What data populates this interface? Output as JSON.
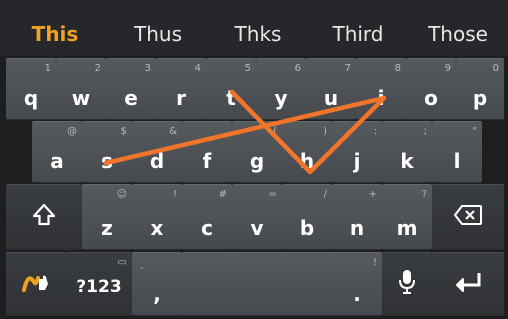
{
  "suggestions": [
    "This",
    "Thus",
    "Thks",
    "Third",
    "Those"
  ],
  "rows": {
    "row1": [
      {
        "char": "q",
        "hint": "1"
      },
      {
        "char": "w",
        "hint": "2"
      },
      {
        "char": "e",
        "hint": "3"
      },
      {
        "char": "r",
        "hint": "4"
      },
      {
        "char": "t",
        "hint": "5"
      },
      {
        "char": "y",
        "hint": "6"
      },
      {
        "char": "u",
        "hint": "7"
      },
      {
        "char": "i",
        "hint": "8"
      },
      {
        "char": "o",
        "hint": "9"
      },
      {
        "char": "p",
        "hint": "0"
      }
    ],
    "row2": [
      {
        "char": "a",
        "hint": "@"
      },
      {
        "char": "s",
        "hint": "$"
      },
      {
        "char": "d",
        "hint": "&"
      },
      {
        "char": "f",
        "hint": "_"
      },
      {
        "char": "g",
        "hint": "("
      },
      {
        "char": "h",
        "hint": ")"
      },
      {
        "char": "j",
        "hint": ":"
      },
      {
        "char": "k",
        "hint": ";"
      },
      {
        "char": "l",
        "hint": "\""
      }
    ],
    "row3": [
      {
        "char": "z",
        "hint": "☺"
      },
      {
        "char": "x",
        "hint": "!"
      },
      {
        "char": "c",
        "hint": "#"
      },
      {
        "char": "v",
        "hint": "="
      },
      {
        "char": "b",
        "hint": "/"
      },
      {
        "char": "n",
        "hint": "+"
      },
      {
        "char": "m",
        "hint": "?"
      }
    ]
  },
  "bottom": {
    "symbols_label": "?123",
    "comma": ",",
    "comma_hint": "-",
    "period": ".",
    "period_hint": "!",
    "symbols_hint": "▭"
  },
  "icons": {
    "shift": "shift-icon",
    "backspace": "backspace-icon",
    "mic": "microphone-icon",
    "enter": "enter-icon",
    "swype": "swype-logo-icon"
  },
  "colors": {
    "accent": "#f1a224",
    "trace": "#f0752a"
  }
}
